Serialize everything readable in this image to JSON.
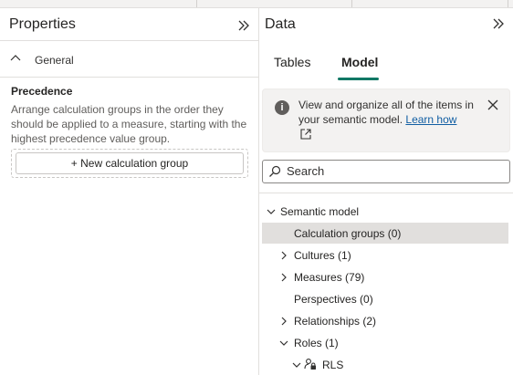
{
  "properties": {
    "title": "Properties",
    "section_label": "General",
    "precedence_title": "Precedence",
    "precedence_description": "Arrange calculation groups in the order they should be applied to a measure, starting with the highest precedence value group.",
    "new_calc_group_label": "+ New calculation group"
  },
  "data_pane": {
    "title": "Data",
    "tabs": [
      {
        "label": "Tables",
        "active": false
      },
      {
        "label": "Model",
        "active": true
      }
    ],
    "info": {
      "text": "View and organize all of the items in your semantic model.",
      "link": "Learn how"
    },
    "search": {
      "placeholder": "Search"
    },
    "tree": {
      "root": "Semantic model",
      "items": [
        {
          "label": "Calculation groups (0)",
          "expand": "none",
          "selected": true
        },
        {
          "label": "Cultures (1)",
          "expand": "collapsed",
          "selected": false
        },
        {
          "label": "Measures (79)",
          "expand": "collapsed",
          "selected": false
        },
        {
          "label": "Perspectives (0)",
          "expand": "none",
          "selected": false
        },
        {
          "label": "Relationships (2)",
          "expand": "collapsed",
          "selected": false
        },
        {
          "label": "Roles (1)",
          "expand": "expanded",
          "selected": false
        }
      ],
      "role_item": {
        "label": "RLS",
        "icon": "role-lock-icon"
      }
    }
  },
  "colors": {
    "accent": "#117865",
    "link": "#115ea3",
    "selected_row": "#e1dfdd"
  }
}
